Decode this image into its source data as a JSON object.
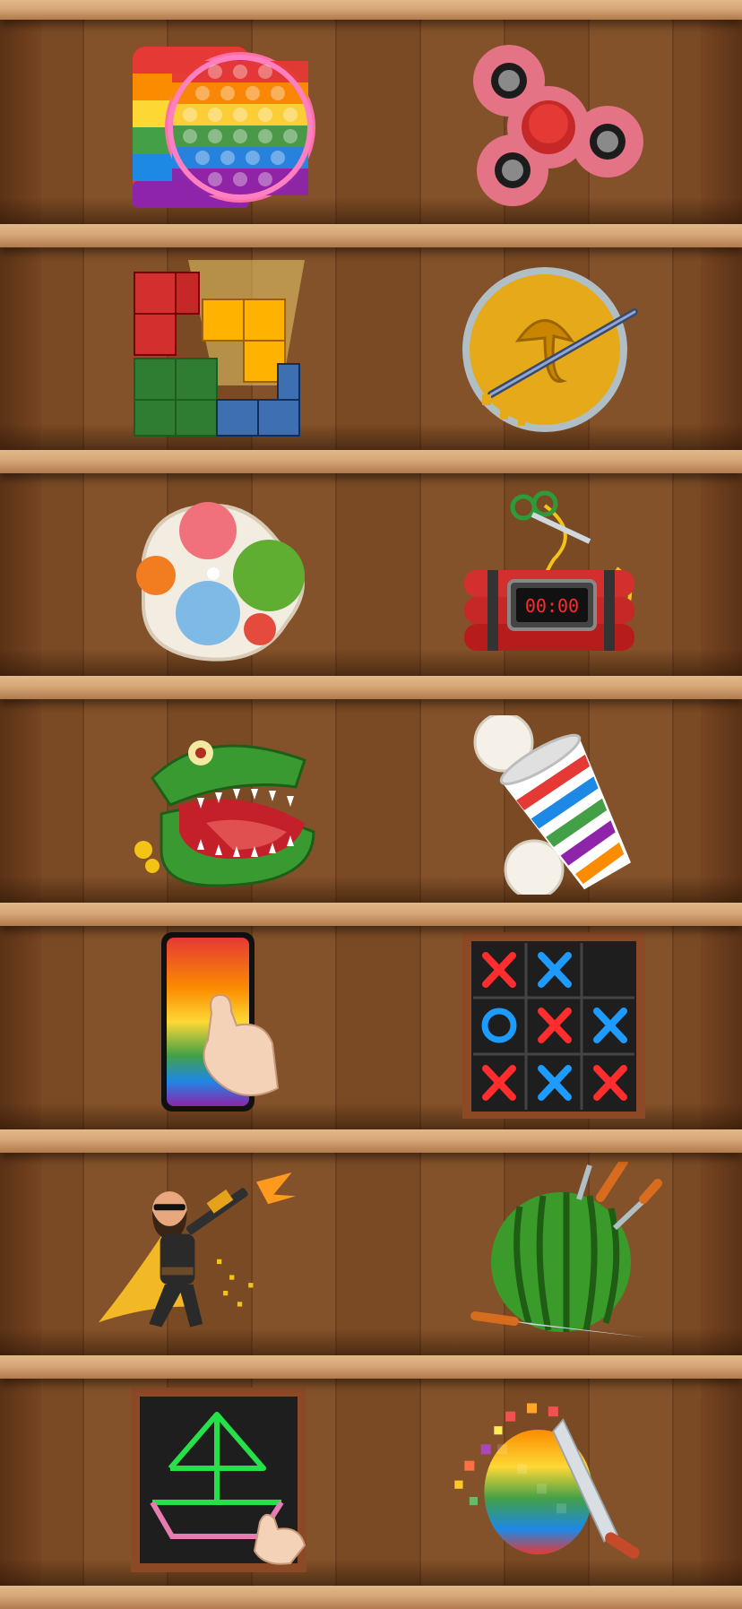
{
  "games": [
    {
      "id": "pop-it",
      "icon": "pop-it-icon"
    },
    {
      "id": "fidget-spinner",
      "icon": "fidget-spinner-icon"
    },
    {
      "id": "block-puzzle",
      "icon": "block-puzzle-icon"
    },
    {
      "id": "honeycomb-candy",
      "icon": "honeycomb-candy-icon"
    },
    {
      "id": "simple-dimple",
      "icon": "simple-dimple-icon"
    },
    {
      "id": "time-bomb",
      "icon": "time-bomb-icon",
      "display": "00:00"
    },
    {
      "id": "crocodile-dentist",
      "icon": "crocodile-dentist-icon"
    },
    {
      "id": "cup-and-balls",
      "icon": "cup-and-balls-icon"
    },
    {
      "id": "phone-swipe",
      "icon": "phone-swipe-icon"
    },
    {
      "id": "tic-tac-toe",
      "icon": "tic-tac-toe-icon"
    },
    {
      "id": "shooter-hero",
      "icon": "shooter-hero-icon"
    },
    {
      "id": "knife-watermelon",
      "icon": "knife-watermelon-icon"
    },
    {
      "id": "line-drawing",
      "icon": "line-drawing-icon"
    },
    {
      "id": "slice-pixels",
      "icon": "slice-pixels-icon"
    }
  ],
  "colors": {
    "shelf": "#d6a677",
    "wood": "#7a4a24",
    "rainbow": [
      "#e53935",
      "#fb8c00",
      "#fdd835",
      "#43a047",
      "#1e88e5",
      "#8e24aa"
    ]
  }
}
